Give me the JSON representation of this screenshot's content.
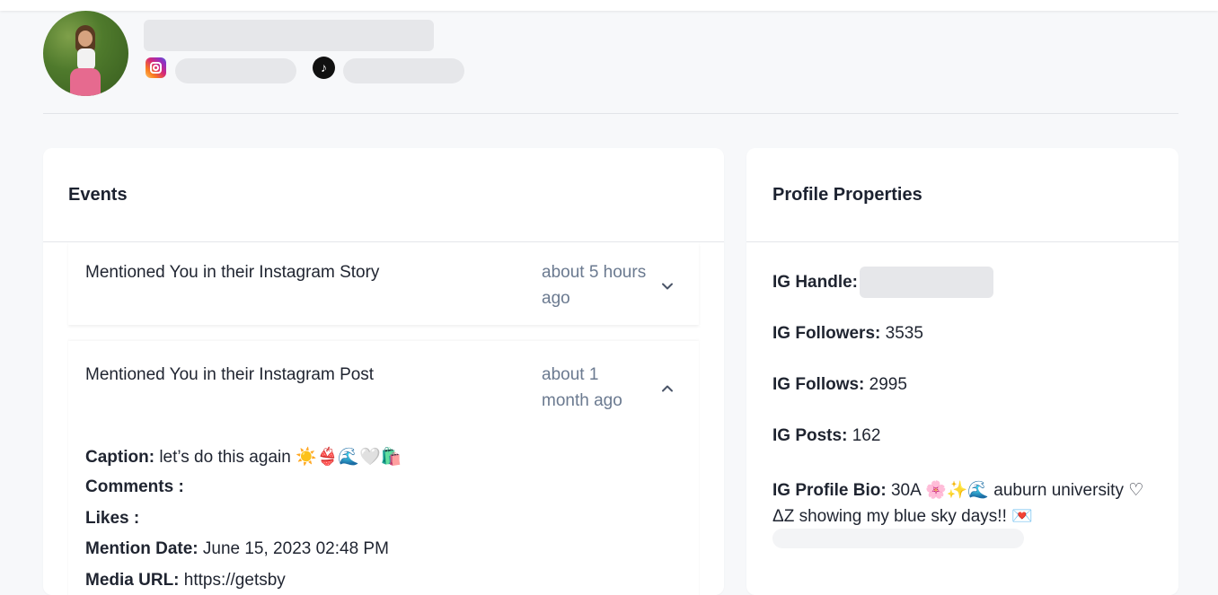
{
  "header": {
    "avatar_icon": "profile-photo",
    "instagram_icon": "instagram-icon",
    "tiktok_icon": "tiktok-icon",
    "tiktok_glyph": "♪"
  },
  "events": {
    "title": "Events",
    "items": [
      {
        "title": "Mentioned You in their Instagram Story",
        "time": "about 5 hours ago",
        "expanded": false
      },
      {
        "title": "Mentioned You in their Instagram Post",
        "time": "about 1 month ago",
        "expanded": true,
        "details": {
          "caption_label": "Caption:",
          "caption_value": "let’s do this again ☀️👙🌊🤍🛍️",
          "comments_label": "Comments :",
          "comments_value": "",
          "likes_label": "Likes :",
          "likes_value": "",
          "mention_label": "Mention Date:",
          "mention_value": "June 15, 2023 02:48 PM",
          "media_label": "Media URL:",
          "media_value": "https://getsby"
        }
      }
    ]
  },
  "profile": {
    "title": "Profile Properties",
    "ig_handle_label": "IG Handle:",
    "ig_followers_label": "IG Followers:",
    "ig_followers_value": "3535",
    "ig_follows_label": "IG Follows:",
    "ig_follows_value": "2995",
    "ig_posts_label": "IG Posts:",
    "ig_posts_value": "162",
    "ig_bio_label": "IG Profile Bio:",
    "ig_bio_value": "30A 🌸✨🌊 auburn university ♡ ΔZ showing my blue sky days!! 💌"
  },
  "colors": {
    "page_bg": "#f7f8fa",
    "card_bg": "#ffffff",
    "muted_text": "#6b7a90",
    "placeholder": "#e6e7ea"
  }
}
